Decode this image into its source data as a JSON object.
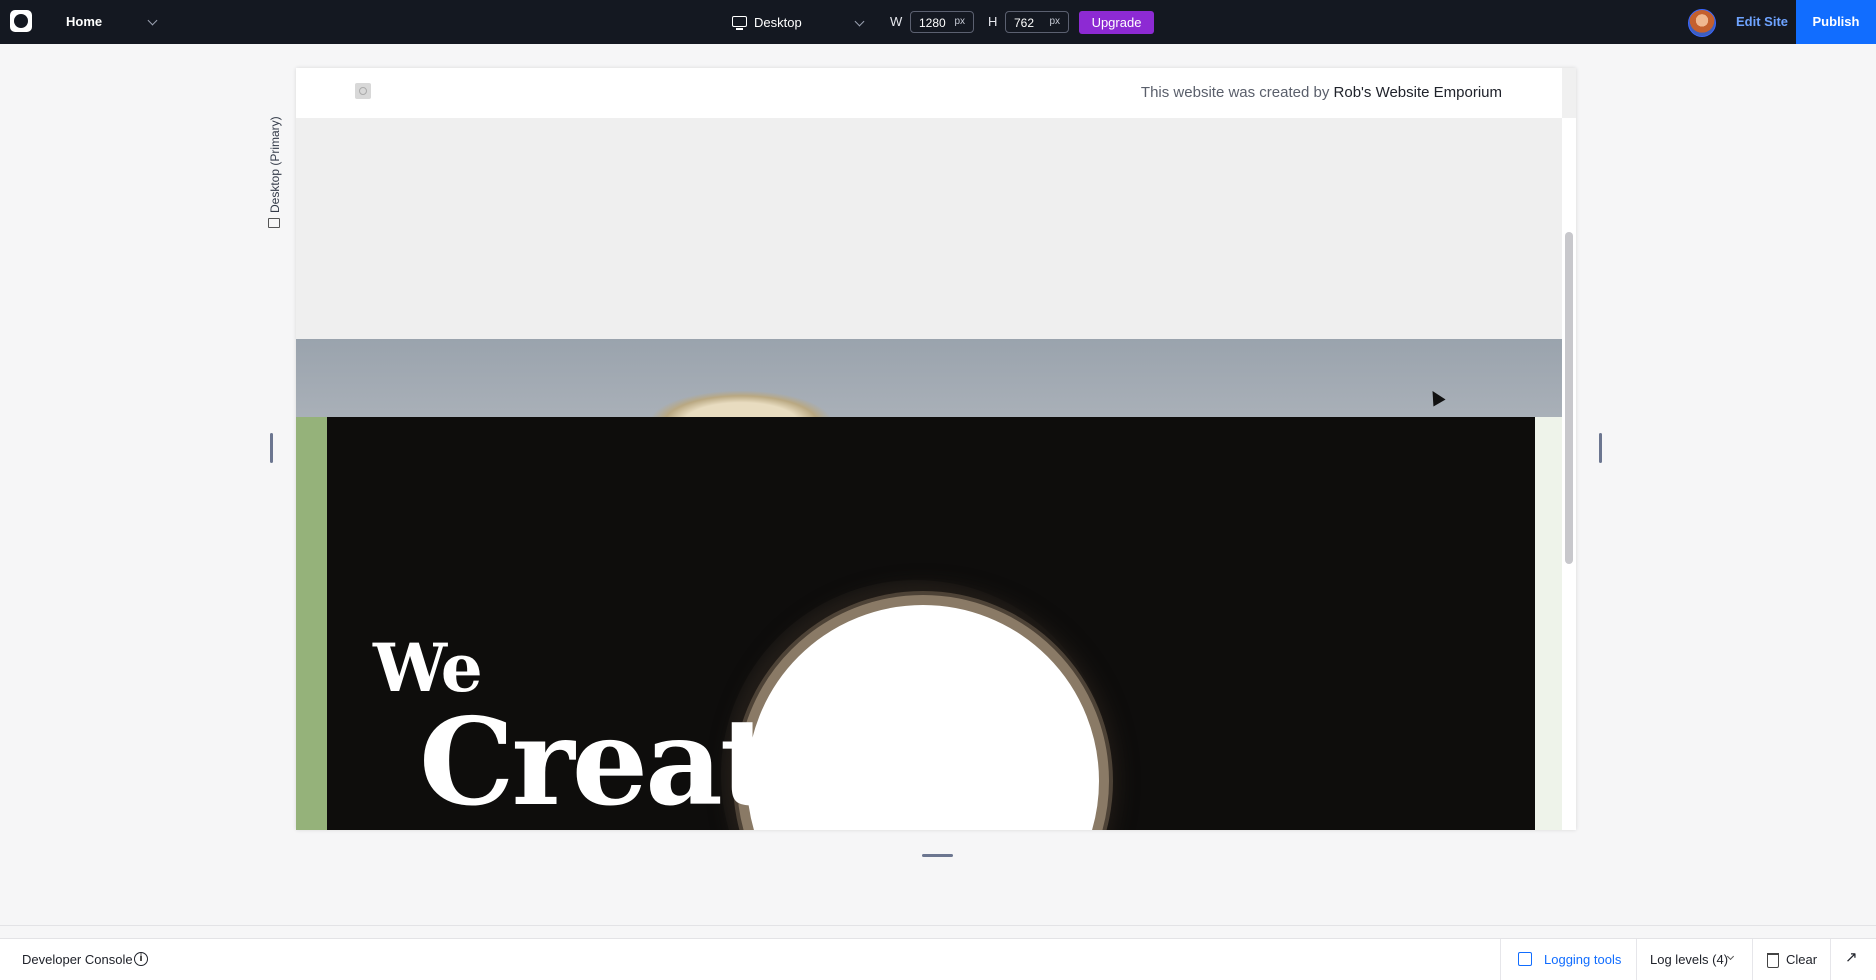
{
  "topbar": {
    "page_label": "Home",
    "device_label": "Desktop",
    "width_label": "W",
    "width_value": "1280",
    "height_label": "H",
    "height_value": "762",
    "unit": "px",
    "upgrade_label": "Upgrade",
    "edit_site_label": "Edit Site",
    "publish_label": "Publish"
  },
  "canvas": {
    "breakpoint_label": "Desktop (Primary)"
  },
  "site": {
    "credit_prefix": "This website was created by",
    "credit_name": "Rob's Website Emporium",
    "hero_line1": "We",
    "hero_line2": "Create"
  },
  "console": {
    "title": "Developer Console",
    "logging_tools": "Logging tools",
    "log_levels": "Log levels (4)",
    "clear": "Clear"
  },
  "colors": {
    "topbar_bg": "#141821",
    "publish_bg": "#116dff",
    "upgrade_bg": "#8d2ad3",
    "link_blue": "#116dff"
  }
}
